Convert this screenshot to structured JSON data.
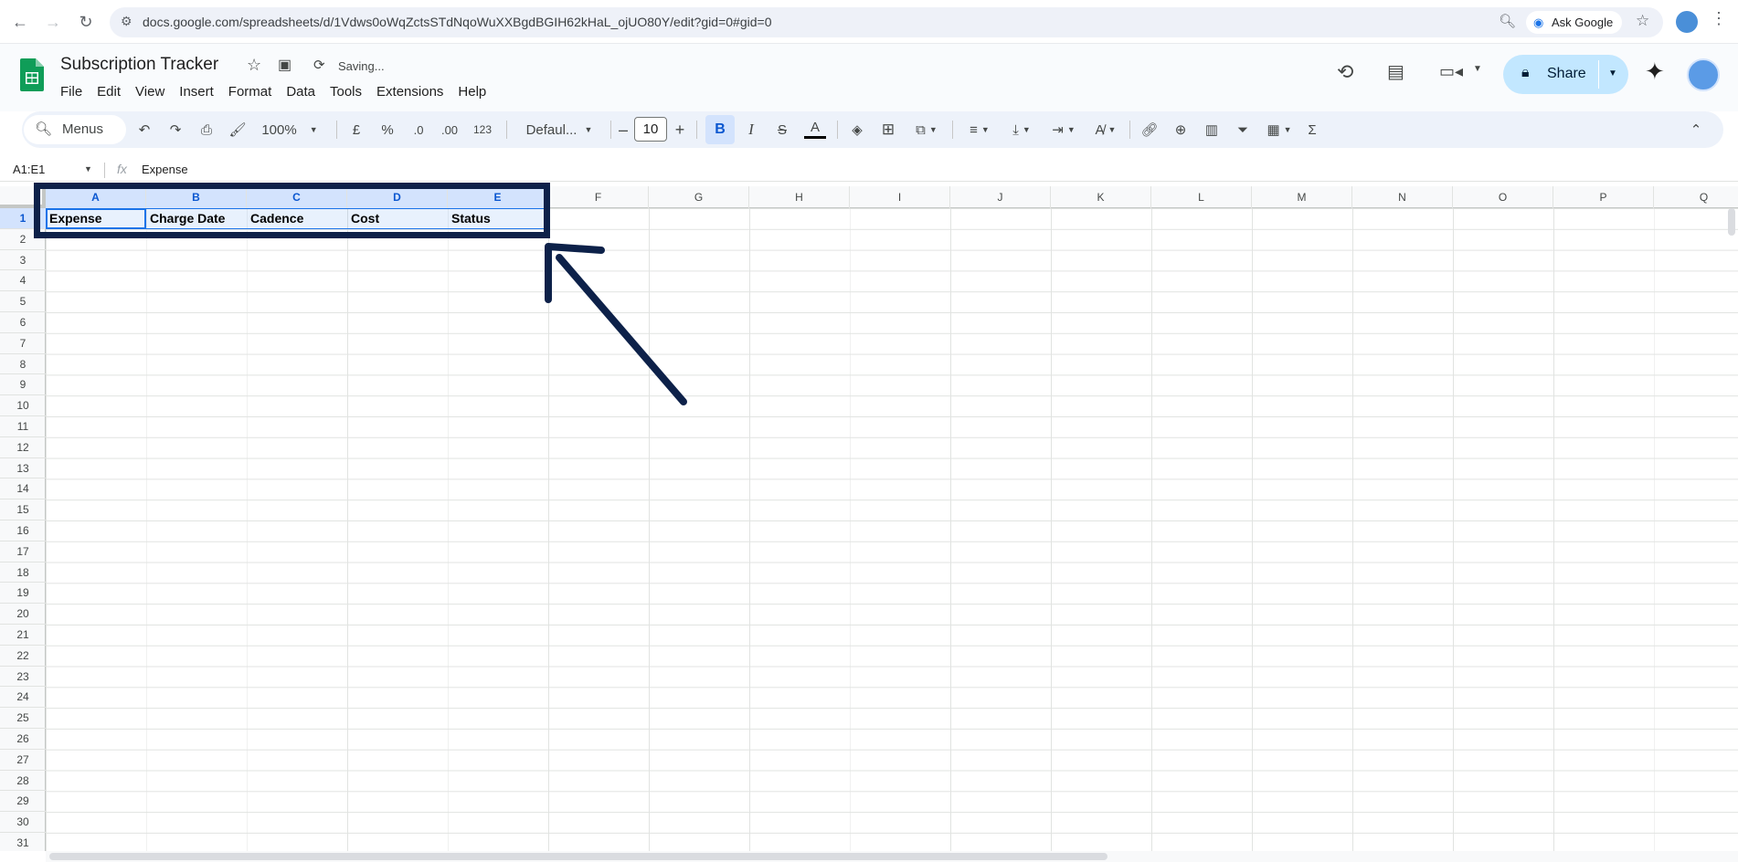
{
  "browser": {
    "url": "docs.google.com/spreadsheets/d/1Vdws0oWqZctsSTdNqoWuXXBgdBGIH62kHaL_ojUO80Y/edit?gid=0#gid=0",
    "ask_google": "Ask Google"
  },
  "app": {
    "title": "Subscription Tracker",
    "status": "Saving...",
    "share_label": "Share",
    "menus": [
      "File",
      "Edit",
      "View",
      "Insert",
      "Format",
      "Data",
      "Tools",
      "Extensions",
      "Help"
    ]
  },
  "toolbar": {
    "search_label": "Menus",
    "zoom": "100%",
    "currency": "£",
    "percent": "%",
    "dec_decrease": ".0",
    "dec_increase": ".00",
    "number_format": "123",
    "font": "Defaul...",
    "font_size": "10",
    "bold": "B",
    "italic": "I",
    "strikethrough": "S",
    "text_color": "A",
    "sum": "Σ"
  },
  "formula_bar": {
    "name_box": "A1:E1",
    "fx": "fx",
    "content": "Expense"
  },
  "sheet": {
    "columns": [
      "A",
      "B",
      "C",
      "D",
      "E",
      "F",
      "G",
      "H",
      "I",
      "J",
      "K",
      "L",
      "M",
      "N",
      "O",
      "P",
      "Q"
    ],
    "rows": [
      "1",
      "2",
      "3",
      "4",
      "5",
      "6",
      "7",
      "8",
      "9",
      "10",
      "11",
      "12",
      "13",
      "14",
      "15",
      "16",
      "17",
      "18",
      "19",
      "20",
      "21",
      "22",
      "23",
      "24",
      "25",
      "26",
      "27",
      "28",
      "29",
      "30",
      "31"
    ],
    "row1": [
      "Expense",
      "Charge Date",
      "Cadence",
      "Cost",
      "Status"
    ]
  },
  "colors": {
    "accent": "#1a73e8",
    "annotation": "#0d2149",
    "share_bg": "#c2e7ff",
    "sheets_green": "#0f9d58"
  }
}
